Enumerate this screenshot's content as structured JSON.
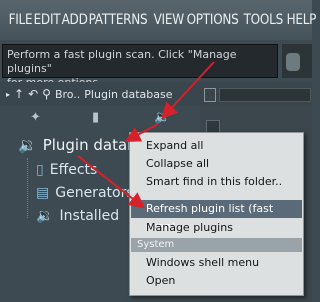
{
  "menubar": {
    "items": [
      "FILE",
      "EDIT",
      "ADD",
      "PATTERNS",
      "VIEW",
      "OPTIONS",
      "TOOLS",
      "HELP"
    ]
  },
  "hint": {
    "line1": "Perform a fast plugin scan. Click \"Manage plugins\"",
    "line2": "for more options."
  },
  "browser": {
    "prefix": "Bro..",
    "title": "Plugin database"
  },
  "tree": {
    "root": "Plugin databas",
    "items": [
      "Effects",
      "Generators",
      "Installed"
    ]
  },
  "context_menu": {
    "items": [
      "Expand all",
      "Collapse all",
      "Smart find in this folder..",
      "Refresh plugin list (fast scan)",
      "Manage plugins"
    ],
    "section": "System",
    "system_items": [
      "Windows shell menu",
      "Open"
    ]
  },
  "colors": {
    "accent": "#66b7ff",
    "arrow": "#d8202a",
    "highlight": "#5a6a78"
  }
}
